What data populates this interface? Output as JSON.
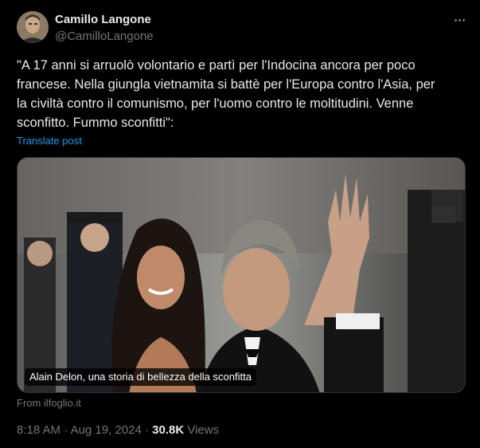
{
  "author": {
    "name": "Camillo Langone",
    "handle": "@CamilloLangone"
  },
  "post": {
    "text_lines": [
      "\"A 17 anni si arruolò volontario e partì per l'Indocina ancora per poco",
      "francese. Nella giungla vietnamita si battè per l'Europa contro l'Asia, per",
      "la civiltà contro il comunismo, per l'uomo contro le moltitudini. Venne",
      "sconfitto. Fummo sconfitti\":"
    ],
    "translate_label": "Translate post"
  },
  "media": {
    "caption": "Alain Delon, una storia di bellezza della sconfitta",
    "source": "From ilfoglio.it"
  },
  "meta": {
    "time": "8:18 AM",
    "separator": "·",
    "date": "Aug 19, 2024",
    "views_count": "30.8K",
    "views_label": "Views"
  },
  "icons": {
    "more": "more-horizontal-icon"
  },
  "colors": {
    "background": "#000000",
    "primary_text": "#e7e9ea",
    "secondary_text": "#71767b",
    "link": "#1d9bf0"
  }
}
